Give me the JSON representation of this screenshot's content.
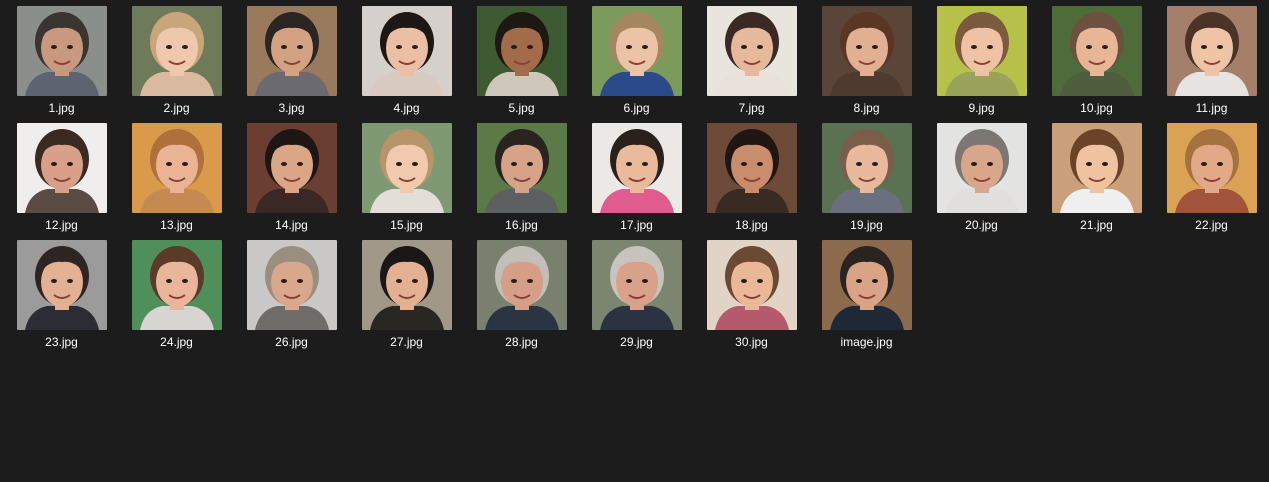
{
  "window": {
    "background": "#1c1c1c"
  },
  "files": [
    {
      "name": "1.jpg",
      "icon": "face-photo-icon",
      "bg": "#8a8f8c",
      "skin": "#c8997e",
      "hair": "#3b3532",
      "shirt": "#5c6470"
    },
    {
      "name": "2.jpg",
      "icon": "face-photo-icon",
      "bg": "#6f7a5a",
      "skin": "#efc7ae",
      "hair": "#c9a57a",
      "shirt": "#d9b9a0"
    },
    {
      "name": "3.jpg",
      "icon": "face-photo-icon",
      "bg": "#9a7a5c",
      "skin": "#d2a283",
      "hair": "#2b2523",
      "shirt": "#6b6a70"
    },
    {
      "name": "4.jpg",
      "icon": "face-photo-icon",
      "bg": "#d6d0cc",
      "skin": "#ebbfa3",
      "hair": "#1d1716",
      "shirt": "#d8c9c1"
    },
    {
      "name": "5.jpg",
      "icon": "face-photo-icon",
      "bg": "#3e5a32",
      "skin": "#a26c4b",
      "hair": "#1e1815",
      "shirt": "#cfc7b9"
    },
    {
      "name": "6.jpg",
      "icon": "face-photo-icon",
      "bg": "#7d9a5d",
      "skin": "#ecc3a6",
      "hair": "#a68660",
      "shirt": "#2b4a8a"
    },
    {
      "name": "7.jpg",
      "icon": "face-photo-icon",
      "bg": "#e8e4de",
      "skin": "#e6b99d",
      "hair": "#3a2a23",
      "shirt": "#e8e2da"
    },
    {
      "name": "8.jpg",
      "icon": "face-photo-icon",
      "bg": "#5b4538",
      "skin": "#e3af92",
      "hair": "#5a3625",
      "shirt": "#4f3a30"
    },
    {
      "name": "9.jpg",
      "icon": "face-photo-icon",
      "bg": "#b7c14a",
      "skin": "#efc2a5",
      "hair": "#7c5a3e",
      "shirt": "#9aa35a"
    },
    {
      "name": "10.jpg",
      "icon": "face-photo-icon",
      "bg": "#4e6b3a",
      "skin": "#e9b597",
      "hair": "#6b513e",
      "shirt": "#4f5e3d"
    },
    {
      "name": "11.jpg",
      "icon": "face-photo-icon",
      "bg": "#a4806a",
      "skin": "#efc3a6",
      "hair": "#4b3427",
      "shirt": "#e7e3e0"
    },
    {
      "name": "12.jpg",
      "icon": "face-photo-icon",
      "bg": "#efeeec",
      "skin": "#d8a088",
      "hair": "#3b2a22",
      "shirt": "#5b4b45"
    },
    {
      "name": "13.jpg",
      "icon": "face-photo-icon",
      "bg": "#d99a4a",
      "skin": "#eab393",
      "hair": "#b0703c",
      "shirt": "#c58a52"
    },
    {
      "name": "14.jpg",
      "icon": "face-photo-icon",
      "bg": "#6a3e30",
      "skin": "#dba686",
      "hair": "#1e1614",
      "shirt": "#3a2824"
    },
    {
      "name": "15.jpg",
      "icon": "face-photo-icon",
      "bg": "#7f9a72",
      "skin": "#f0c9ae",
      "hair": "#b89568",
      "shirt": "#e3ded8"
    },
    {
      "name": "16.jpg",
      "icon": "face-photo-icon",
      "bg": "#5b7a48",
      "skin": "#d6a288",
      "hair": "#2a2421",
      "shirt": "#5d6061"
    },
    {
      "name": "17.jpg",
      "icon": "face-photo-icon",
      "bg": "#ebe8e5",
      "skin": "#e9bb9c",
      "hair": "#2a201c",
      "shirt": "#e05b8e"
    },
    {
      "name": "18.jpg",
      "icon": "face-photo-icon",
      "bg": "#6d4a38",
      "skin": "#c98d6e",
      "hair": "#1f1612",
      "shirt": "#3a2a24"
    },
    {
      "name": "19.jpg",
      "icon": "face-photo-icon",
      "bg": "#5a7252",
      "skin": "#e9b99d",
      "hair": "#7a5e4a",
      "shirt": "#6a7080"
    },
    {
      "name": "20.jpg",
      "icon": "face-photo-icon",
      "bg": "#e3e3e1",
      "skin": "#d8a68a",
      "hair": "#7c7772",
      "shirt": "#e0dfdd"
    },
    {
      "name": "21.jpg",
      "icon": "face-photo-icon",
      "bg": "#caa07a",
      "skin": "#efc2a2",
      "hair": "#6b4328",
      "shirt": "#efefef"
    },
    {
      "name": "22.jpg",
      "icon": "face-photo-icon",
      "bg": "#d9a255",
      "skin": "#e2a989",
      "hair": "#a5723f",
      "shirt": "#a0553b"
    },
    {
      "name": "23.jpg",
      "icon": "face-photo-icon",
      "bg": "#9b9b9b",
      "skin": "#e2b194",
      "hair": "#2e2522",
      "shirt": "#2c2d34"
    },
    {
      "name": "24.jpg",
      "icon": "face-photo-icon",
      "bg": "#4e8f5a",
      "skin": "#eab69b",
      "hair": "#5a3a29",
      "shirt": "#d8d4d1"
    },
    {
      "name": "26.jpg",
      "icon": "face-photo-icon",
      "bg": "#c9c8c6",
      "skin": "#d8a78c",
      "hair": "#9a8e80",
      "shirt": "#6f6c6a"
    },
    {
      "name": "27.jpg",
      "icon": "face-photo-icon",
      "bg": "#a29888",
      "skin": "#e3b191",
      "hair": "#1a1716",
      "shirt": "#2a2624"
    },
    {
      "name": "28.jpg",
      "icon": "face-photo-icon",
      "bg": "#7a806e",
      "skin": "#d59f87",
      "hair": "#c2beb8",
      "shirt": "#2a3443"
    },
    {
      "name": "29.jpg",
      "icon": "face-photo-icon",
      "bg": "#7c8570",
      "skin": "#d7a18a",
      "hair": "#c8c4bd",
      "shirt": "#2b3242"
    },
    {
      "name": "30.jpg",
      "icon": "face-photo-icon",
      "bg": "#e1d4c6",
      "skin": "#eab898",
      "hair": "#6a4a33",
      "shirt": "#b5596c"
    },
    {
      "name": "image.jpg",
      "icon": "face-photo-icon",
      "bg": "#8c6a4e",
      "skin": "#d9a385",
      "hair": "#2b2320",
      "shirt": "#1f2837"
    }
  ]
}
